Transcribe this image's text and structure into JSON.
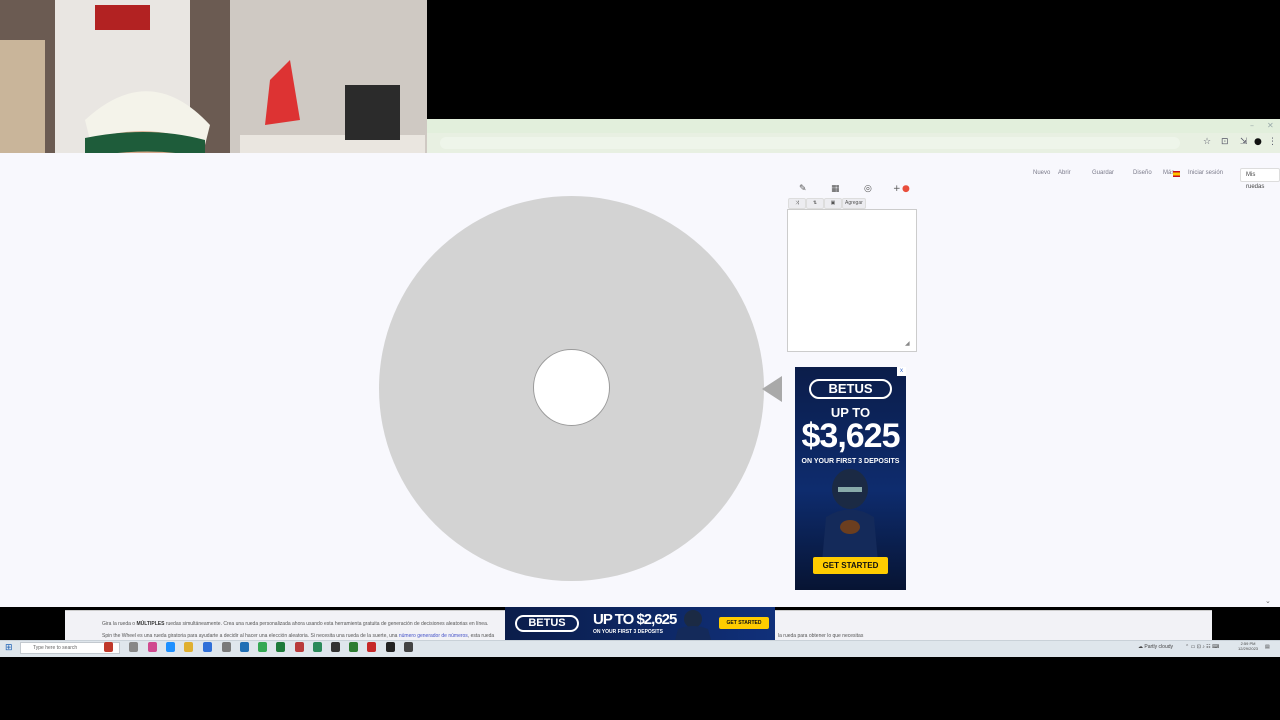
{
  "browser": {
    "win_min": "–",
    "win_close": "✕",
    "icons": [
      "star-icon",
      "reader-icon",
      "extension-icon",
      "profile-icon",
      "menu-icon"
    ]
  },
  "nav": {
    "items": [
      "Nuevo",
      "Abrir",
      "Guardar",
      "Diseño"
    ],
    "settings": "Más",
    "lang": "es",
    "account": "Iniciar sesión",
    "mis_ruedas": "Mis ruedas"
  },
  "editor": {
    "add_label": "Agregar",
    "placeholder": ""
  },
  "ad": {
    "logo": "BETUS",
    "up_to": "UP TO",
    "amount": "$3,625",
    "sub": "ON YOUR FIRST 3 DEPOSITS",
    "cta": "GET STARTED",
    "close": "x"
  },
  "banner": {
    "logo": "BETUS",
    "amount": "UP TO $2,625",
    "sub": "ON YOUR FIRST 3 DEPOSITS",
    "cta": "GET STARTED"
  },
  "description": {
    "line1_a": "Gira la rueda o ",
    "line1_b": "MÚLTIPLES",
    "line1_c": " ruedas simultáneamente. Crea una rueda personalizada ahora usando esta herramienta gratuita de generación de decisiones aleatorias en línea.",
    "line2_a": "Spin the Wheel es una rueda giratoria para ayudarte a decidir al hacer una elección aleatoria. Si necesita una rueda de la suerte, una ",
    "line2_link": "número generador de números",
    "line2_b": ", esta rueda",
    "line2_tail": "la rueda para obtener lo que necesitas"
  },
  "taskbar": {
    "search_placeholder": "Type here to search",
    "weather": "Partly cloudy",
    "time": "2:59 PM",
    "date": "12/29/2023"
  }
}
